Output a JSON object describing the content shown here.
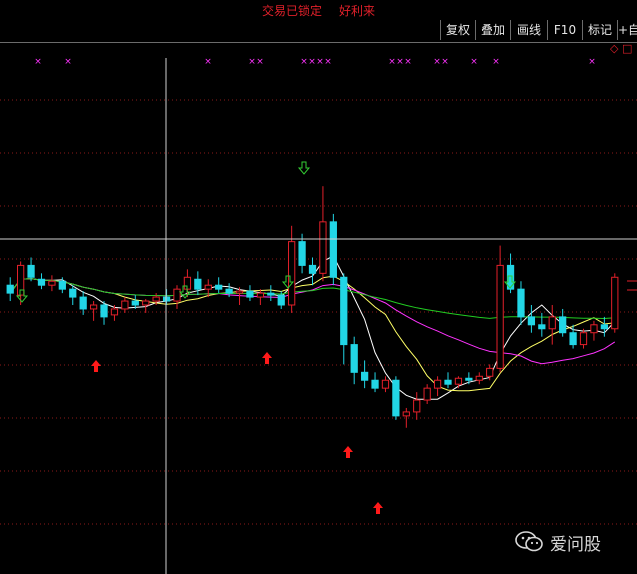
{
  "status": {
    "lock_text": "交易已锁定",
    "tag_text": "好利来",
    "color": "#e0202a"
  },
  "toolbar": {
    "buttons": [
      {
        "label": "复权"
      },
      {
        "label": "叠加"
      },
      {
        "label": "画线"
      },
      {
        "label": "F10"
      },
      {
        "label": "标记"
      },
      {
        "label": "+自"
      }
    ]
  },
  "corner_icons": "◇ □",
  "watermark": {
    "text": "爱问股",
    "icon": "wechat-icon"
  },
  "colors": {
    "up": "#e4202a",
    "down": "#22d6e6",
    "ma5": "#ffffff",
    "ma10": "#ffff66",
    "ma20": "#ff33ff",
    "ma60": "#22cc22",
    "marker": "#ff33ff",
    "buy_arrow": "#ff1a1a",
    "sell_arrow": "#33cc33",
    "grid": "#8b1a1a",
    "crosshair": "#d0d0d0"
  },
  "chart_data": {
    "type": "candlestick",
    "title": "",
    "ylim": [
      0,
      100
    ],
    "candles": [
      {
        "o": 60,
        "h": 64,
        "l": 52,
        "c": 56
      },
      {
        "o": 55,
        "h": 72,
        "l": 50,
        "c": 70
      },
      {
        "o": 70,
        "h": 74,
        "l": 62,
        "c": 64
      },
      {
        "o": 63,
        "h": 66,
        "l": 58,
        "c": 60
      },
      {
        "o": 60,
        "h": 65,
        "l": 57,
        "c": 62
      },
      {
        "o": 62,
        "h": 64,
        "l": 56,
        "c": 58
      },
      {
        "o": 58,
        "h": 60,
        "l": 50,
        "c": 54
      },
      {
        "o": 54,
        "h": 57,
        "l": 45,
        "c": 48
      },
      {
        "o": 48,
        "h": 52,
        "l": 42,
        "c": 50
      },
      {
        "o": 50,
        "h": 52,
        "l": 40,
        "c": 44
      },
      {
        "o": 45,
        "h": 50,
        "l": 42,
        "c": 48
      },
      {
        "o": 48,
        "h": 54,
        "l": 46,
        "c": 52
      },
      {
        "o": 52,
        "h": 55,
        "l": 48,
        "c": 50
      },
      {
        "o": 50,
        "h": 53,
        "l": 46,
        "c": 52
      },
      {
        "o": 52,
        "h": 56,
        "l": 50,
        "c": 54
      },
      {
        "o": 54,
        "h": 58,
        "l": 50,
        "c": 52
      },
      {
        "o": 52,
        "h": 60,
        "l": 48,
        "c": 58
      },
      {
        "o": 58,
        "h": 68,
        "l": 54,
        "c": 64
      },
      {
        "o": 63,
        "h": 67,
        "l": 55,
        "c": 58
      },
      {
        "o": 58,
        "h": 63,
        "l": 54,
        "c": 60
      },
      {
        "o": 60,
        "h": 64,
        "l": 56,
        "c": 58
      },
      {
        "o": 58,
        "h": 61,
        "l": 54,
        "c": 56
      },
      {
        "o": 56,
        "h": 59,
        "l": 50,
        "c": 57
      },
      {
        "o": 57,
        "h": 60,
        "l": 52,
        "c": 54
      },
      {
        "o": 54,
        "h": 58,
        "l": 50,
        "c": 56
      },
      {
        "o": 56,
        "h": 60,
        "l": 52,
        "c": 55
      },
      {
        "o": 55,
        "h": 57,
        "l": 48,
        "c": 50
      },
      {
        "o": 50,
        "h": 90,
        "l": 46,
        "c": 82
      },
      {
        "o": 82,
        "h": 86,
        "l": 66,
        "c": 70
      },
      {
        "o": 70,
        "h": 74,
        "l": 60,
        "c": 66
      },
      {
        "o": 66,
        "h": 110,
        "l": 62,
        "c": 92
      },
      {
        "o": 92,
        "h": 96,
        "l": 60,
        "c": 64
      },
      {
        "o": 64,
        "h": 66,
        "l": 20,
        "c": 30
      },
      {
        "o": 30,
        "h": 34,
        "l": 10,
        "c": 16
      },
      {
        "o": 16,
        "h": 22,
        "l": 8,
        "c": 12
      },
      {
        "o": 12,
        "h": 16,
        "l": 6,
        "c": 8
      },
      {
        "o": 8,
        "h": 14,
        "l": 6,
        "c": 12
      },
      {
        "o": 12,
        "h": 14,
        "l": -8,
        "c": -6
      },
      {
        "o": -6,
        "h": -2,
        "l": -12,
        "c": -4
      },
      {
        "o": -4,
        "h": 6,
        "l": -8,
        "c": 2
      },
      {
        "o": 2,
        "h": 10,
        "l": 0,
        "c": 8
      },
      {
        "o": 8,
        "h": 14,
        "l": 4,
        "c": 12
      },
      {
        "o": 12,
        "h": 16,
        "l": 8,
        "c": 10
      },
      {
        "o": 10,
        "h": 14,
        "l": 8,
        "c": 13
      },
      {
        "o": 13,
        "h": 16,
        "l": 10,
        "c": 12
      },
      {
        "o": 12,
        "h": 16,
        "l": 10,
        "c": 14
      },
      {
        "o": 14,
        "h": 20,
        "l": 12,
        "c": 18
      },
      {
        "o": 18,
        "h": 80,
        "l": 16,
        "c": 70
      },
      {
        "o": 70,
        "h": 76,
        "l": 56,
        "c": 58
      },
      {
        "o": 58,
        "h": 62,
        "l": 40,
        "c": 44
      },
      {
        "o": 44,
        "h": 50,
        "l": 36,
        "c": 40
      },
      {
        "o": 40,
        "h": 46,
        "l": 34,
        "c": 38
      },
      {
        "o": 38,
        "h": 50,
        "l": 30,
        "c": 44
      },
      {
        "o": 44,
        "h": 48,
        "l": 34,
        "c": 36
      },
      {
        "o": 36,
        "h": 40,
        "l": 28,
        "c": 30
      },
      {
        "o": 30,
        "h": 38,
        "l": 28,
        "c": 36
      },
      {
        "o": 36,
        "h": 42,
        "l": 32,
        "c": 40
      },
      {
        "o": 40,
        "h": 44,
        "l": 34,
        "c": 38
      },
      {
        "o": 38,
        "h": 66,
        "l": 36,
        "c": 64
      }
    ]
  }
}
